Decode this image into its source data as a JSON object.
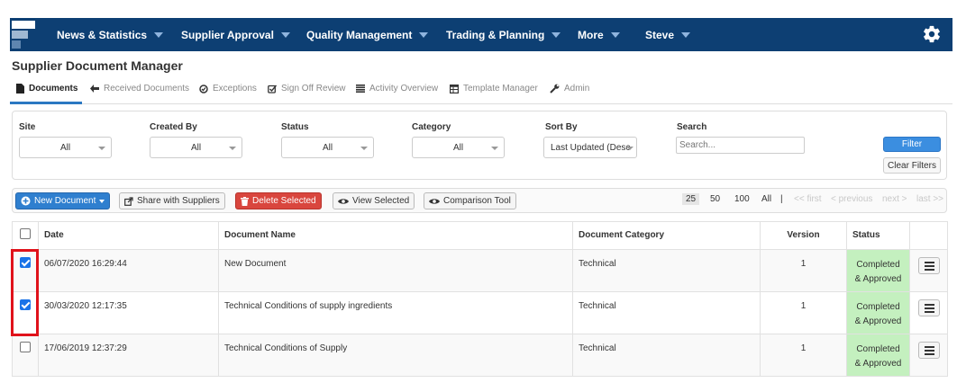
{
  "nav": {
    "items": [
      "News & Statistics",
      "Supplier Approval",
      "Quality Management",
      "Trading & Planning",
      "More",
      "Steve"
    ]
  },
  "page": {
    "title": "Supplier Document Manager"
  },
  "tabs": [
    {
      "label": "Documents",
      "icon": "document-icon",
      "active": true
    },
    {
      "label": "Received Documents",
      "icon": "arrow-left-icon"
    },
    {
      "label": "Exceptions",
      "icon": "check-circle-icon"
    },
    {
      "label": "Sign Off Review",
      "icon": "check-square-icon"
    },
    {
      "label": "Activity Overview",
      "icon": "list-icon"
    },
    {
      "label": "Template Manager",
      "icon": "table-icon"
    },
    {
      "label": "Admin",
      "icon": "wrench-icon"
    }
  ],
  "filters": {
    "site": {
      "label": "Site",
      "value": "All"
    },
    "created_by": {
      "label": "Created By",
      "value": "All"
    },
    "status": {
      "label": "Status",
      "value": "All"
    },
    "category": {
      "label": "Category",
      "value": "All"
    },
    "sort_by": {
      "label": "Sort By",
      "value": "Last Updated (Desc"
    },
    "search": {
      "label": "Search",
      "placeholder": "Search..."
    },
    "filter_button": "Filter",
    "clear_button": "Clear Filters"
  },
  "actions": {
    "new_document": "New Document",
    "share": "Share with Suppliers",
    "delete": "Delete Selected",
    "view": "View Selected",
    "compare": "Comparison Tool"
  },
  "pagination": {
    "sizes": [
      "25",
      "50",
      "100",
      "All"
    ],
    "selected": "25",
    "separator": "|",
    "first": "<< first",
    "previous": "< previous",
    "next": "next >",
    "last": "last >>"
  },
  "table": {
    "columns": [
      "Date",
      "Document Name",
      "Document Category",
      "Version",
      "Status"
    ],
    "rows": [
      {
        "checked": true,
        "date": "06/07/2020 16:29:44",
        "name": "New Document",
        "category": "Technical",
        "version": "1",
        "status_line1": "Completed",
        "status_line2": "& Approved"
      },
      {
        "checked": true,
        "date": "30/03/2020 12:17:35",
        "name": "Technical Conditions of supply ingredients",
        "category": "Technical",
        "version": "1",
        "status_line1": "Completed",
        "status_line2": "& Approved"
      },
      {
        "checked": false,
        "date": "17/06/2019 12:37:29",
        "name": "Technical Conditions of Supply",
        "category": "Technical",
        "version": "1",
        "status_line1": "Completed",
        "status_line2": "& Approved"
      }
    ]
  },
  "colors": {
    "nav_bg": "#0d3f73",
    "primary": "#2f7fcf",
    "danger": "#d9463e",
    "status_green": "#c4f0bf",
    "highlight": "#e0121b"
  }
}
